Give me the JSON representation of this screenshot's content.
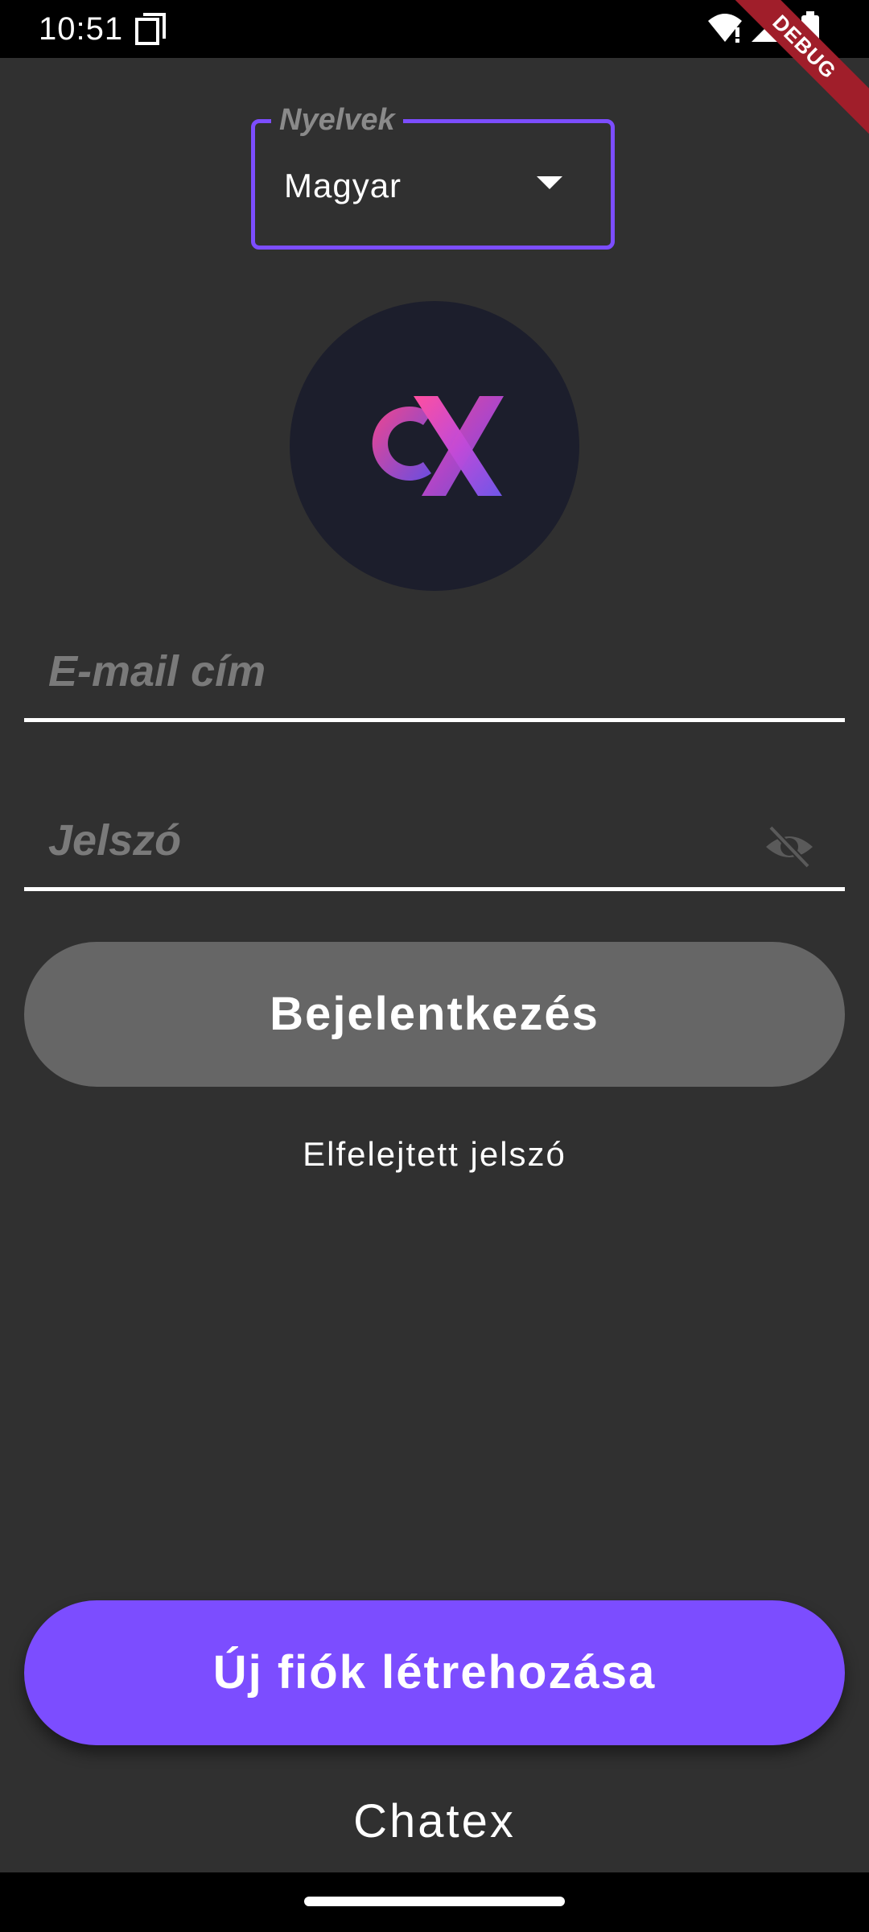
{
  "status_bar": {
    "time": "10:51",
    "icons": [
      "screenshot-icon",
      "wifi-icon",
      "signal-icon",
      "battery-icon"
    ],
    "debug_label": "DEBUG"
  },
  "language": {
    "label": "Nyelvek",
    "selected": "Magyar"
  },
  "logo": {
    "text": "CX",
    "colors": [
      "#e23a8a",
      "#7c4dff"
    ]
  },
  "form": {
    "email_placeholder": "E-mail cím",
    "password_placeholder": "Jelszó",
    "password_visibility_icon": "eye-off-icon"
  },
  "actions": {
    "login_label": "Bejelentkezés",
    "forgot_password_label": "Elfelejtett jelszó",
    "register_label": "Új fiók létrehozása"
  },
  "footer": {
    "app_name": "Chatex"
  },
  "colors": {
    "background": "#303030",
    "accent": "#7c4dff",
    "disabled_button": "#666666"
  }
}
